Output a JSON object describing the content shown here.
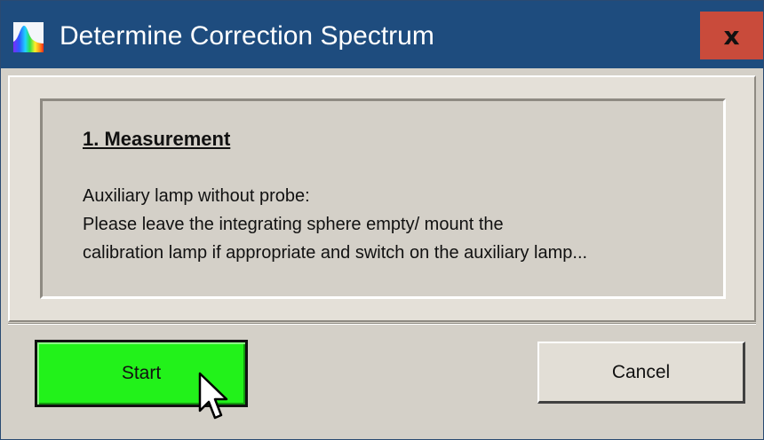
{
  "window": {
    "title": "Determine Correction Spectrum",
    "close_symbol": "x"
  },
  "content": {
    "heading": "1. Measurement",
    "lines": [
      "Auxiliary lamp without probe:",
      "Please leave the integrating sphere empty/ mount the",
      "calibration lamp if appropriate and switch on the auxiliary lamp..."
    ]
  },
  "buttons": {
    "start_label": "Start",
    "cancel_label": "Cancel"
  },
  "colors": {
    "titlebar": "#1e4c7e",
    "close_button": "#c94b3b",
    "start_button": "#22f21a",
    "window_background": "#d4d0c8"
  },
  "icons": {
    "app": "spectrum-icon",
    "close": "close-icon",
    "cursor": "mouse-pointer-icon"
  }
}
